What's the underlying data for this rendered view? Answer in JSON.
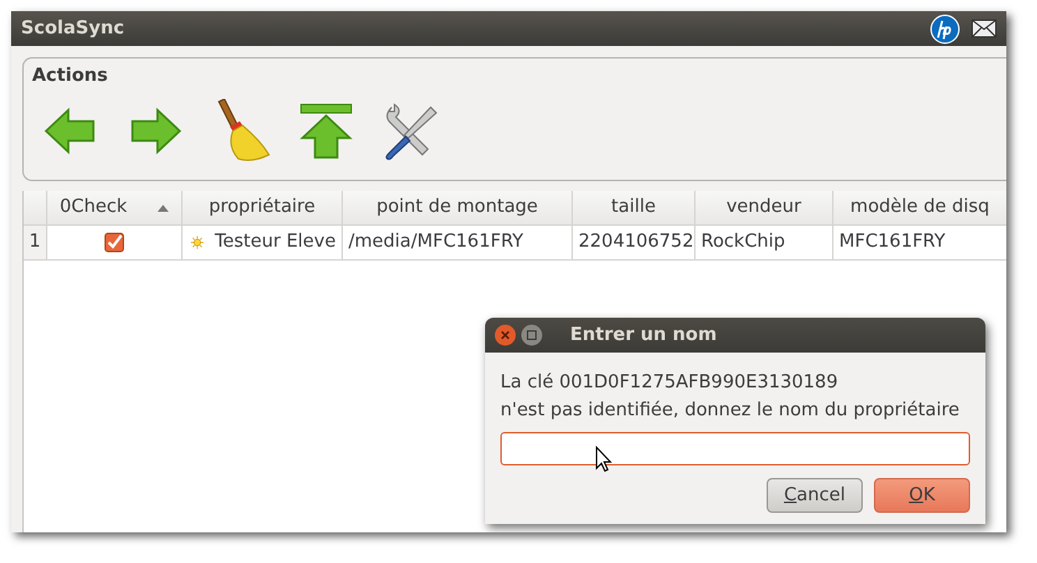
{
  "window": {
    "title": "ScolaSync"
  },
  "actions": {
    "title": "Actions"
  },
  "table": {
    "columns": [
      {
        "label": "0Check",
        "sorted": true
      },
      {
        "label": "propriétaire",
        "sorted": false
      },
      {
        "label": "point de montage",
        "sorted": false
      },
      {
        "label": "taille",
        "sorted": false
      },
      {
        "label": "vendeur",
        "sorted": false
      },
      {
        "label": "modèle de disq",
        "sorted": false
      }
    ],
    "rows": [
      {
        "number": "1",
        "checked": true,
        "owner": "Testeur Eleve",
        "mount": "/media/MFC161FRY",
        "size": "2204106752",
        "vendor": "RockChip",
        "model": "MFC161FRY"
      }
    ]
  },
  "dialog": {
    "title": "Entrer un nom",
    "message_lines": [
      "La clé 001D0F1275AFB990E3130189",
      "n'est pas identifiée, donnez le nom du propriétaire"
    ],
    "buttons": [
      {
        "label": "Cancel",
        "kind": "secondary"
      },
      {
        "label": "OK",
        "kind": "default"
      }
    ]
  }
}
